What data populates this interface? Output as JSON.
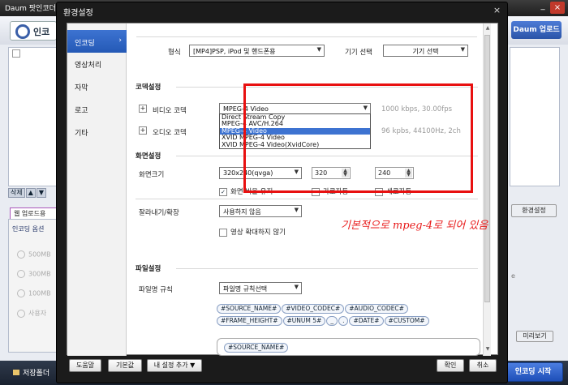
{
  "app": {
    "title": "Daum 팟인코더",
    "logo_text": "인코",
    "daum_upload": "Daum 업로드",
    "list_buttons": [
      "삭제",
      "▲",
      "▼"
    ],
    "upload_tab": "웹 업로드용",
    "panel_head": "인코딩 옵션",
    "radio_options": [
      "500MB",
      "300MB",
      "100MB",
      "사용자"
    ],
    "env_button": "환경설정",
    "preview_button": "미리보기",
    "save_folder": "저장폴더",
    "start_button": "인코딩 시작",
    "right_text": "e"
  },
  "dialog": {
    "title": "환경설정",
    "close": "×",
    "nav": [
      {
        "label": "인코딩",
        "active": true
      },
      {
        "label": "영상처리",
        "active": false
      },
      {
        "label": "자막",
        "active": false
      },
      {
        "label": "로고",
        "active": false
      },
      {
        "label": "기타",
        "active": false
      }
    ],
    "format_label": "형식",
    "format_value": "[MP4]PSP, iPod 및 핸드폰용",
    "device_label": "기기 선택",
    "device_button": "기기 선택",
    "codec_section": "코덱설정",
    "video_codec_label": "비디오 코덱",
    "video_codec_value": "MPEG-4 Video",
    "video_bitrate": "1000 kbps, 30.00fps",
    "audio_codec_label": "오디오 코덱",
    "audio_bitrate": "96 kpbs, 44100Hz, 2ch",
    "codec_options": [
      {
        "label": "Direct Stream Copy",
        "highlighted": false
      },
      {
        "label": "MPEG-4 AVC/H.264",
        "highlighted": false
      },
      {
        "label": "MPEG-4 Video",
        "highlighted": true
      },
      {
        "label": "XVID MPEG-4 Video",
        "highlighted": false
      },
      {
        "label": "XVID MPEG-4 Video(XvidCore)",
        "highlighted": false
      }
    ],
    "screen_section": "화면설정",
    "size_label": "화면크기",
    "size_value": "320x240(qvga)",
    "width": "320",
    "height": "240",
    "keep_ratio": "화면 비율 유지",
    "width_auto": "가로자동",
    "height_auto": "세로자동",
    "crop_label": "잘라내기/확장",
    "crop_value": "사용하지 않음",
    "no_upscale": "영상 확대하지 않기",
    "file_section": "파일설정",
    "filename_rule_label": "파일명 규칙",
    "filename_rule_button": "파일명 규칙선택",
    "tags": [
      "#SOURCE_NAME#",
      "#VIDEO_CODEC#",
      "#AUDIO_CODEC#",
      "#FRAME_HEIGHT#",
      "#UNUM 5#",
      "_",
      ".",
      "#DATE#",
      "#CUSTOM#"
    ],
    "filename_value": "#SOURCE_NAME#",
    "annotation": "기본적으로 mpeg-4로 되어 있음",
    "footer": {
      "help": "도움말",
      "default": "기본값",
      "my_settings": "내 설정 추가",
      "ok": "확인",
      "cancel": "취소"
    }
  }
}
